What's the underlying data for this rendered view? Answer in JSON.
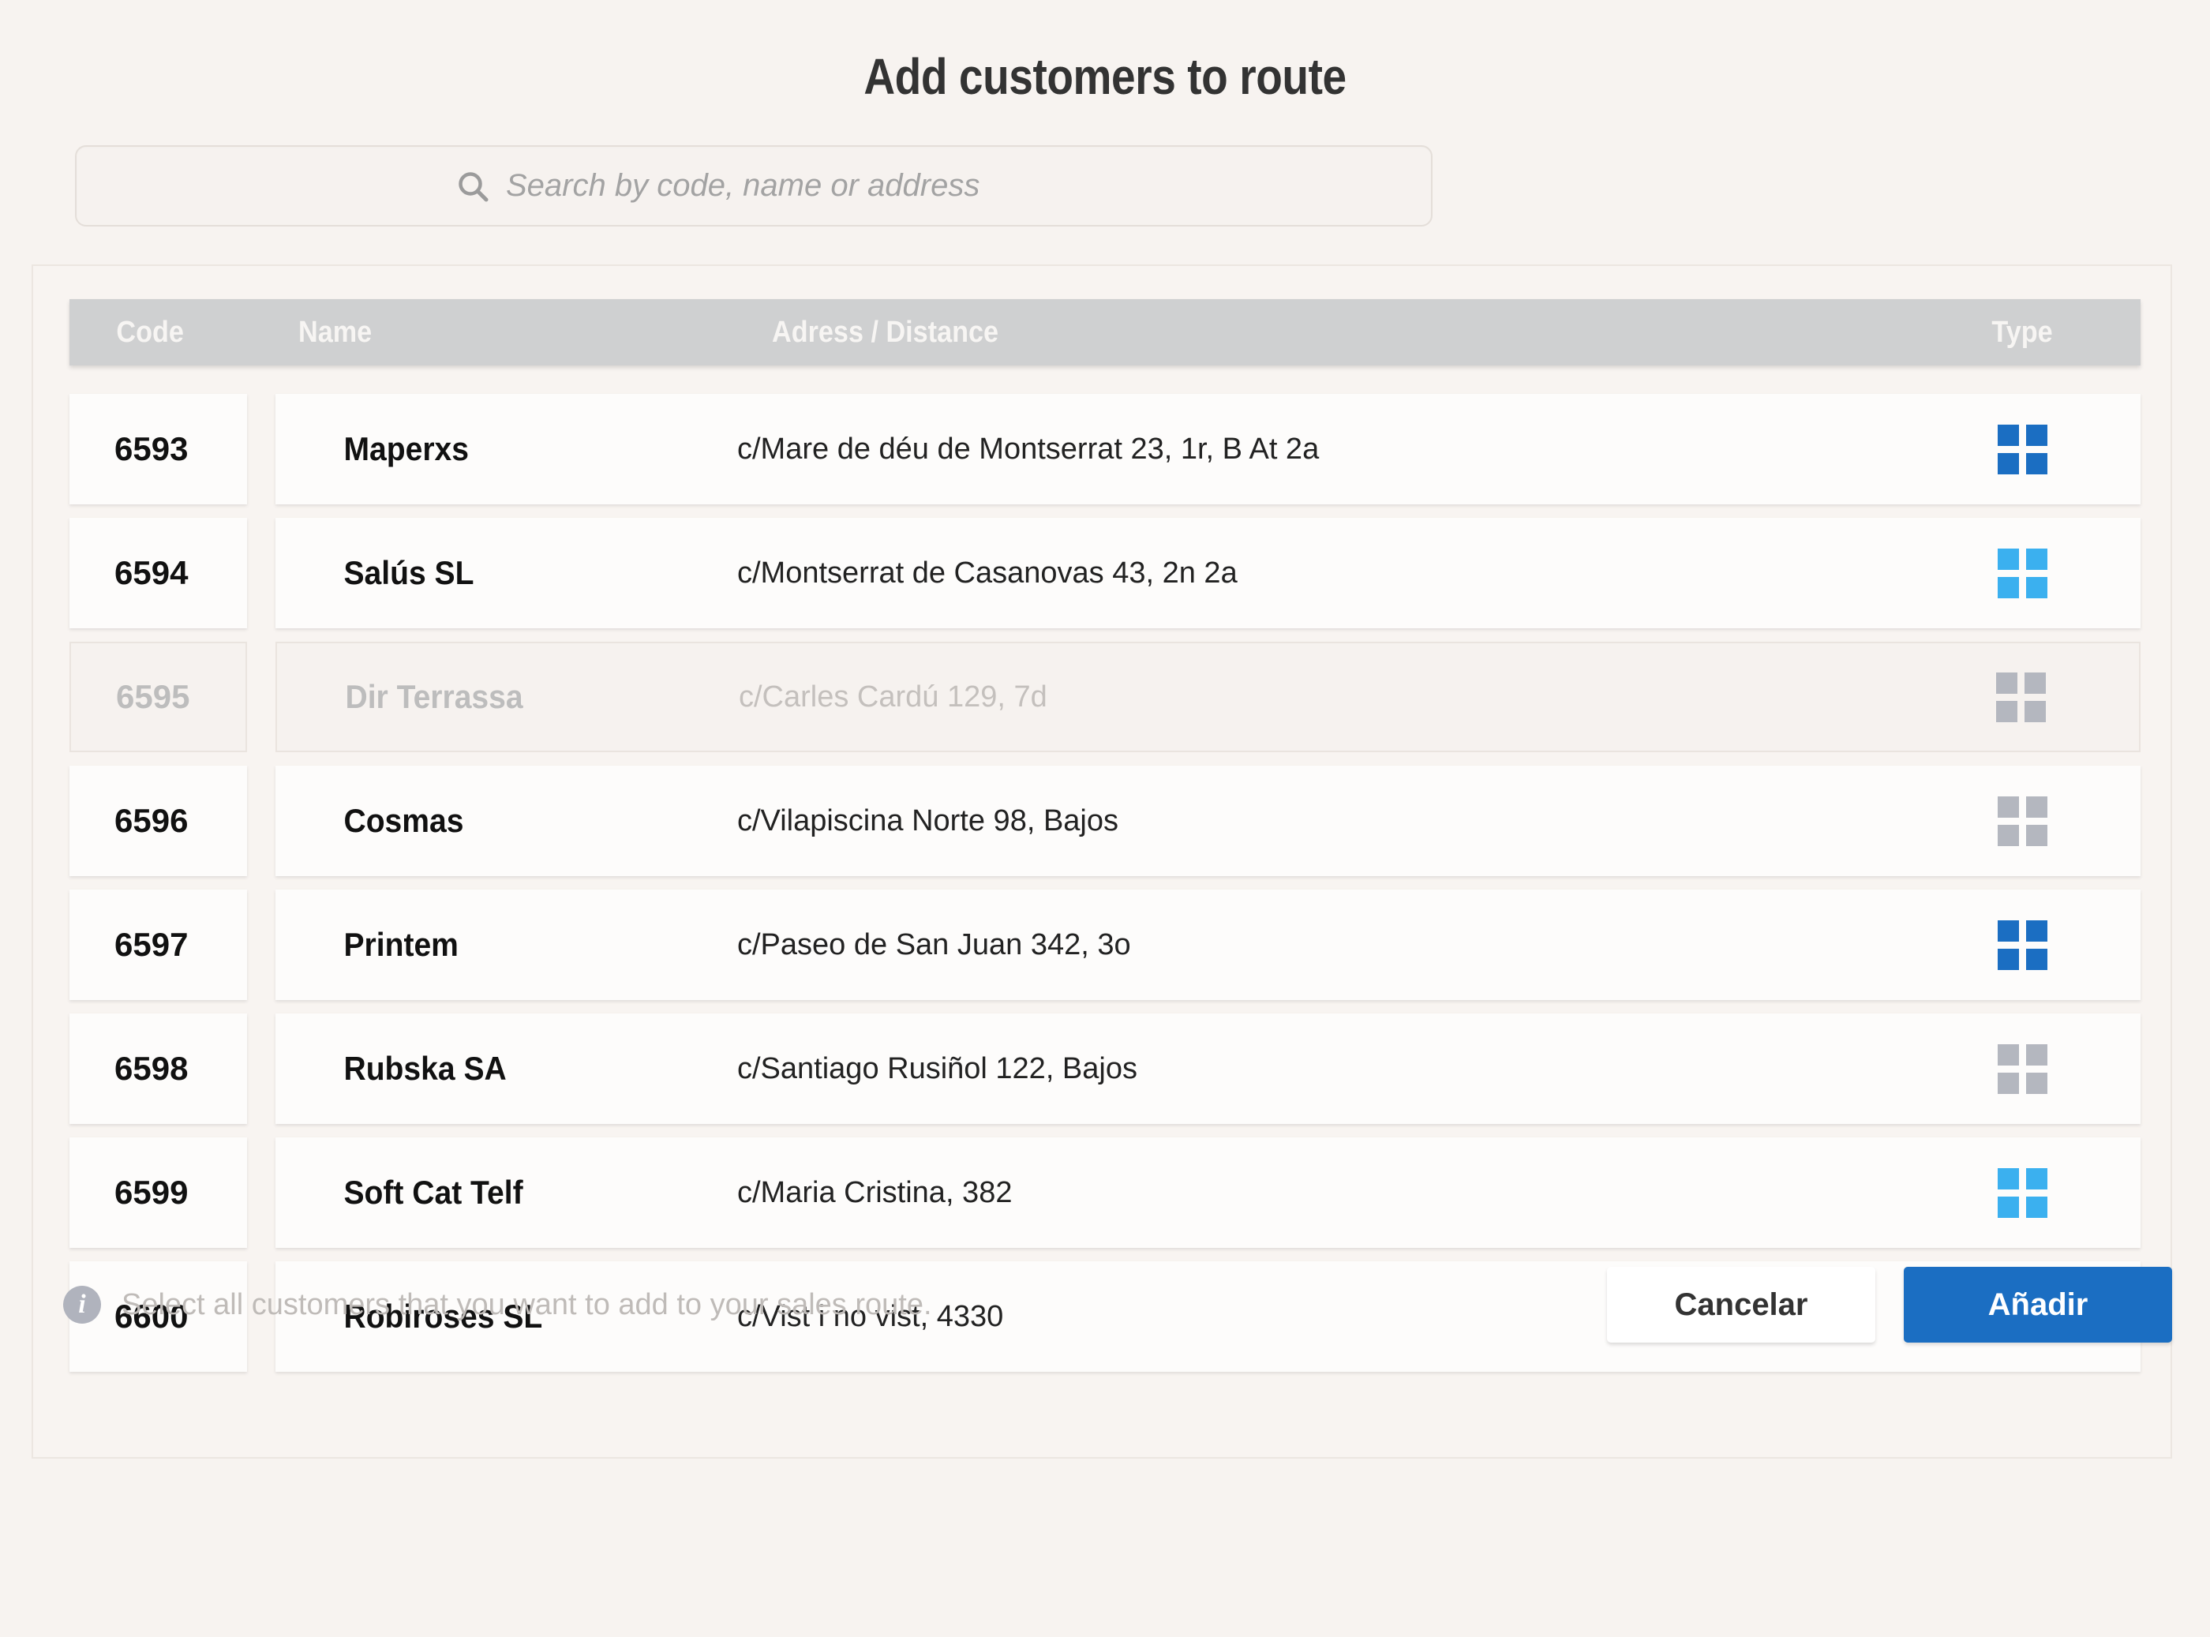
{
  "header": {
    "title": "Add customers to route"
  },
  "search": {
    "icon": "search-icon",
    "placeholder": "Search by code, name or address",
    "value": ""
  },
  "table": {
    "columns": {
      "code": "Code",
      "name": "Name",
      "address": "Adress / Distance",
      "type": "Type"
    },
    "rows": [
      {
        "code": "6593",
        "name": "Maperxs",
        "address": "c/Mare de déu de Montserrat 23, 1r, B At 2a",
        "type": "dark",
        "disabled": false
      },
      {
        "code": "6594",
        "name": "Salús SL",
        "address": "c/Montserrat de Casanovas 43, 2n 2a",
        "type": "light",
        "disabled": false
      },
      {
        "code": "6595",
        "name": "Dir Terrassa",
        "address": "c/Carles Cardú 129, 7d",
        "type": "gray",
        "disabled": true
      },
      {
        "code": "6596",
        "name": "Cosmas",
        "address": "c/Vilapiscina Norte 98, Bajos",
        "type": "gray",
        "disabled": false
      },
      {
        "code": "6597",
        "name": "Printem",
        "address": "c/Paseo de San Juan 342, 3o",
        "type": "dark",
        "disabled": false
      },
      {
        "code": "6598",
        "name": "Rubska SA",
        "address": "c/Santiago Rusiñol 122, Bajos",
        "type": "gray",
        "disabled": false
      },
      {
        "code": "6599",
        "name": "Soft Cat Telf",
        "address": "c/Maria Cristina, 382",
        "type": "light",
        "disabled": false
      },
      {
        "code": "6600",
        "name": "Robiroses SL",
        "address": "c/Vist i no vist, 4330",
        "type": "gray",
        "disabled": false
      }
    ]
  },
  "footer": {
    "info_icon": "info-icon",
    "hint": "Select all customers that you want to add to your sales route.",
    "cancel_label": "Cancelar",
    "add_label": "Añadir"
  },
  "colors": {
    "background": "#f7f3f0",
    "primary": "#1b6ec2",
    "accent_light": "#3bb0ef",
    "muted": "#b4b7bf",
    "header_band": "#cfd0d1",
    "title": "#333333"
  }
}
